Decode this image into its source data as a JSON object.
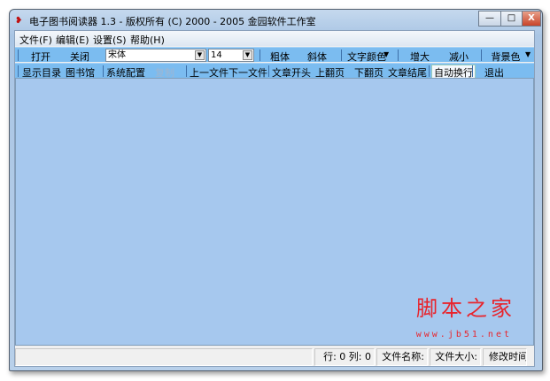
{
  "window": {
    "title": "电子图书阅读器 1.3  -  版权所有 (C) 2000 - 2005 金园软件工作室",
    "minimize": "—",
    "maximize": "□",
    "close": "X"
  },
  "menu": [
    "文件(F)",
    "编辑(E)",
    "设置(S)",
    "帮助(H)"
  ],
  "toolbar1": {
    "open": "打开",
    "close": "关闭",
    "font": "宋体",
    "size": "14",
    "bold": "粗体",
    "italic": "斜体",
    "text_color": "文字颜色",
    "bigger": "增大",
    "smaller": "减小",
    "bg_color": "背景色",
    "arrow": "▼"
  },
  "toolbar2": {
    "toc": "显示目录",
    "library": "图书馆",
    "config": "系统配置",
    "copy": "复制",
    "prev_file": "上一文件",
    "next_file": "下一文件",
    "doc_start": "文章开头",
    "page_up": "上翻页",
    "page_down": "下翻页",
    "doc_end": "文章结尾",
    "wrap": "自动换行",
    "exit": "退出"
  },
  "watermark": {
    "text": "脚本之家",
    "url": "www.jb51.net"
  },
  "status": {
    "pos": "行: 0  列: 0",
    "filename": "文件名称:",
    "filesize": "文件大小:",
    "modified": "修改时间"
  }
}
